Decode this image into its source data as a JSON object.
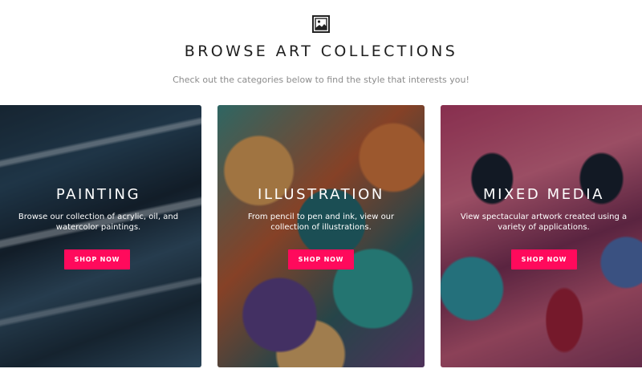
{
  "header": {
    "icon": "image-icon",
    "title": "BROWSE ART COLLECTIONS",
    "subtitle": "Check out the categories below to find the style that interests you!"
  },
  "cards": [
    {
      "title": "PAINTING",
      "description": "Browse our collection of acrylic, oil, and watercolor paintings.",
      "button_label": "SHOP NOW"
    },
    {
      "title": "ILLUSTRATION",
      "description": "From pencil to pen and ink, view our collection of illustrations.",
      "button_label": "SHOP NOW"
    },
    {
      "title": "MIXED MEDIA",
      "description": "View spectacular artwork created using a variety of applications.",
      "button_label": "SHOP NOW"
    }
  ],
  "colors": {
    "accent": "#ff0a5c",
    "title_text": "#1f1f1f",
    "subtitle_text": "#8c8c8c"
  }
}
